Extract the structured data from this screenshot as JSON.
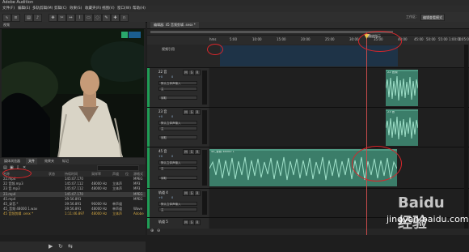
{
  "app": {
    "title": "Adobe Audition"
  },
  "menu": [
    "文件(F)",
    "编辑(E)",
    "多轨剪辑(M)",
    "剪辑(C)",
    "效果(S)",
    "收藏夹(R)",
    "视图(V)",
    "窗口(W)",
    "帮助(H)"
  ],
  "workspace": {
    "label": "工作区：",
    "button": "编辑查看模式"
  },
  "video_panel": {
    "tab": "视频"
  },
  "files_panel": {
    "tabs": [
      "媒体浏览器",
      "文件",
      "效果夹",
      "标记"
    ],
    "columns": [
      "名称",
      "状态",
      "持续时间",
      "采样率",
      "声道",
      "位",
      "源格式"
    ],
    "rows": [
      {
        "name": "22.mp4",
        "duration": "145:07.170",
        "rate": "",
        "ch": "",
        "fmt": "MPEG"
      },
      {
        "name": "22 音频.mp3",
        "duration": "145:07.112",
        "rate": "48000 Hz",
        "ch": "立体声",
        "fmt": "MP3"
      },
      {
        "name": "23 音.mp3",
        "duration": "145:07.112",
        "rate": "48000 Hz",
        "ch": "立体声",
        "fmt": "MP3"
      },
      {
        "name": "23.mp4",
        "duration": "145:07.170",
        "rate": "",
        "ch": "",
        "fmt": "MPEG"
      },
      {
        "name": "45.mp4",
        "duration": "39:56.891",
        "rate": "",
        "ch": "",
        "fmt": "MPEG"
      },
      {
        "name": "45_录音.*",
        "duration": "39:56.891",
        "rate": "96000 Hz",
        "ch": "单声道",
        "fmt": ""
      },
      {
        "name": "45_音频 48000 1.wav",
        "duration": "39:56.891",
        "rate": "48000 Hz",
        "ch": "单声道",
        "fmt": "Wave"
      },
      {
        "name": "45 音频剪辑 .sesx *",
        "duration": "1:11:46.897",
        "rate": "48000 Hz",
        "ch": "立体声",
        "fmt": "Adobe"
      }
    ]
  },
  "editor": {
    "tab": "编辑器: 45 音频剪辑 .sesx *",
    "ruler": [
      "hms",
      "5:00",
      "10:00",
      "15:00",
      "20:00",
      "25:00",
      "30:00",
      "35:00",
      "40:00",
      "45:00",
      "50:00",
      "55:00",
      "1:00:00",
      "1:05:00"
    ],
    "playhead_label": "播放指示",
    "video_track": "视频引用",
    "tracks": [
      {
        "name": "22 音",
        "input": "默认立体声输入",
        "output": "主",
        "mode": "读取",
        "clip": "22 音频",
        "vol": "+0",
        "pan": "0"
      },
      {
        "name": "23 音",
        "input": "默认立体声输入",
        "output": "主",
        "mode": "读取",
        "clip": "23 音",
        "vol": "+0",
        "pan": "0"
      },
      {
        "name": "45 音",
        "input": "默认立体声输入",
        "output": "主",
        "mode": "读取",
        "clip": "45_音频 48000 1",
        "vol": "+0",
        "pan": "0"
      },
      {
        "name": "轨道 4",
        "input": "默认立体声输入",
        "output": "主",
        "mode": "读取",
        "clip": "",
        "vol": "+0",
        "pan": "0"
      },
      {
        "name": "轨道 5",
        "input": "",
        "output": "",
        "mode": "",
        "clip": "",
        "vol": "",
        "pan": ""
      }
    ]
  },
  "watermark": {
    "text": "Baidu 经验",
    "url": "jingyan.baidu.com"
  }
}
